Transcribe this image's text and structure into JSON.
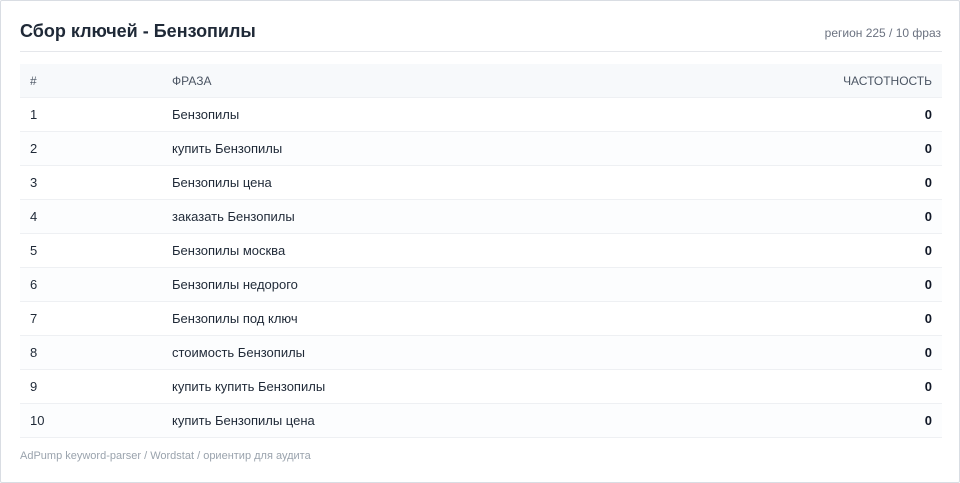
{
  "header": {
    "title": "Сбор ключей - Бензопилы",
    "meta": "регион 225 / 10 фраз"
  },
  "table": {
    "columns": {
      "num": "#",
      "phrase": "ФРАЗА",
      "freq": "ЧАСТОТНОСТЬ"
    },
    "rows": [
      {
        "num": "1",
        "phrase": "Бензопилы",
        "freq": "0"
      },
      {
        "num": "2",
        "phrase": "купить Бензопилы",
        "freq": "0"
      },
      {
        "num": "3",
        "phrase": "Бензопилы цена",
        "freq": "0"
      },
      {
        "num": "4",
        "phrase": "заказать Бензопилы",
        "freq": "0"
      },
      {
        "num": "5",
        "phrase": "Бензопилы москва",
        "freq": "0"
      },
      {
        "num": "6",
        "phrase": "Бензопилы недорого",
        "freq": "0"
      },
      {
        "num": "7",
        "phrase": "Бензопилы под ключ",
        "freq": "0"
      },
      {
        "num": "8",
        "phrase": "стоимость Бензопилы",
        "freq": "0"
      },
      {
        "num": "9",
        "phrase": "купить купить Бензопилы",
        "freq": "0"
      },
      {
        "num": "10",
        "phrase": "купить Бензопилы цена",
        "freq": "0"
      }
    ]
  },
  "footer": {
    "note": "AdPump keyword-parser / Wordstat / ориентир для аудита"
  }
}
